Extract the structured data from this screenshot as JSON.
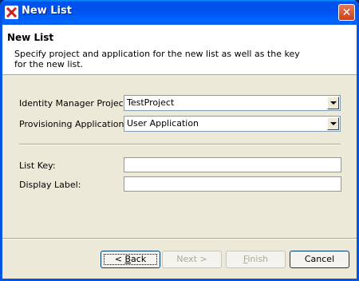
{
  "window": {
    "title": "New List",
    "close_symbol": "✕"
  },
  "header": {
    "title": "New List",
    "description": "Specify project and application for the new list as well as the key for the new list."
  },
  "form": {
    "project_label": "Identity Manager Project:",
    "project_value": "TestProject",
    "application_label": "Provisioning Application:",
    "application_value": "User Application",
    "list_key_label": "List Key:",
    "list_key_value": "",
    "display_label_label": "Display Label:",
    "display_label_value": ""
  },
  "buttons": {
    "back": {
      "pre": "< ",
      "mnemonic": "B",
      "post": "ack"
    },
    "next": "Next >",
    "finish": {
      "mnemonic": "F",
      "post": "inish"
    },
    "cancel": "Cancel"
  },
  "icons": {
    "app": "novell-designer-icon",
    "close": "close-icon",
    "dropdown": "chevron-down-icon"
  },
  "colors": {
    "titlebar": "#0054e3",
    "window_bg": "#ece9d8",
    "close_button": "#c9411c"
  }
}
